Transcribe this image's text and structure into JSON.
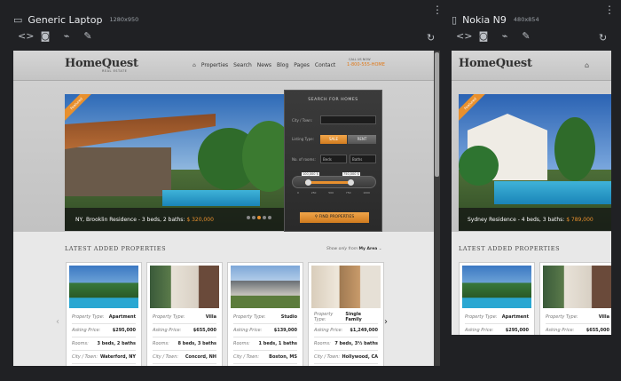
{
  "devices": [
    {
      "name": "Generic Laptop",
      "size": "1280x950",
      "site": {
        "logo": "HomeQuest",
        "logo_sub": "REAL ESTATE",
        "nav": [
          "Properties",
          "Search",
          "News",
          "Blog",
          "Pages",
          "Contact"
        ],
        "call_us": "CALL US NOW",
        "phone": "1-800-555-HOME",
        "featured_tag": "Featured",
        "caption_text": "NY, Brooklin Residence - 3 beds, 2 baths:",
        "caption_price": "$ 320,000",
        "search": {
          "title": "SEARCH FOR HOMES",
          "city_label": "City / Town:",
          "listing_label": "Listing Type:",
          "sale": "SALE",
          "rent": "RENT",
          "rooms_label": "No. of rooms:",
          "beds": "Beds",
          "baths": "Baths",
          "price_min": "100,000 $",
          "price_max": "750,000 $",
          "ticks": [
            "0",
            "250",
            "500",
            "750",
            "1000"
          ],
          "find_button": "FIND PROPERTIES"
        },
        "latest_title": "LATEST ADDED PROPERTIES",
        "show_only": "Show only from",
        "show_area": "My Area",
        "cards": [
          {
            "type": "Apartment",
            "price": "$295,000",
            "rooms": "3 beds, 2 baths",
            "city": "Waterford, NY"
          },
          {
            "type": "Villa",
            "price": "$655,000",
            "rooms": "8 beds, 3 baths",
            "city": "Concord, NH"
          },
          {
            "type": "Studio",
            "price": "$139,000",
            "rooms": "1 beds, 1 baths",
            "city": "Boston, MS"
          },
          {
            "type": "Single Family",
            "price": "$1,249,000",
            "rooms": "7 beds, 3½ baths",
            "city": "Hollywood, CA"
          }
        ],
        "labels": {
          "type": "Property Type:",
          "price": "Asking Price:",
          "rooms": "Rooms:",
          "city": "City / Town:"
        }
      }
    },
    {
      "name": "Nokia N9",
      "size": "480x854",
      "site": {
        "logo": "HomeQuest",
        "featured_tag": "Featured",
        "caption_text": "Sydney Residence - 4 beds, 3 baths:",
        "caption_price": "$ 789,000",
        "latest_title": "LATEST ADDED PROPERTIES",
        "cards": [
          {
            "type": "Apartment",
            "price": "$295,000"
          },
          {
            "type": "Villa",
            "price": "$655,000"
          }
        ],
        "labels": {
          "type": "Property Type:",
          "price": "Asking Price:"
        }
      }
    }
  ],
  "icons": {
    "device": "laptop-icon",
    "phone": "phone-icon",
    "tools": [
      "code-icon",
      "screenshot-icon",
      "network-icon",
      "edit-icon",
      "rotate-icon"
    ]
  }
}
